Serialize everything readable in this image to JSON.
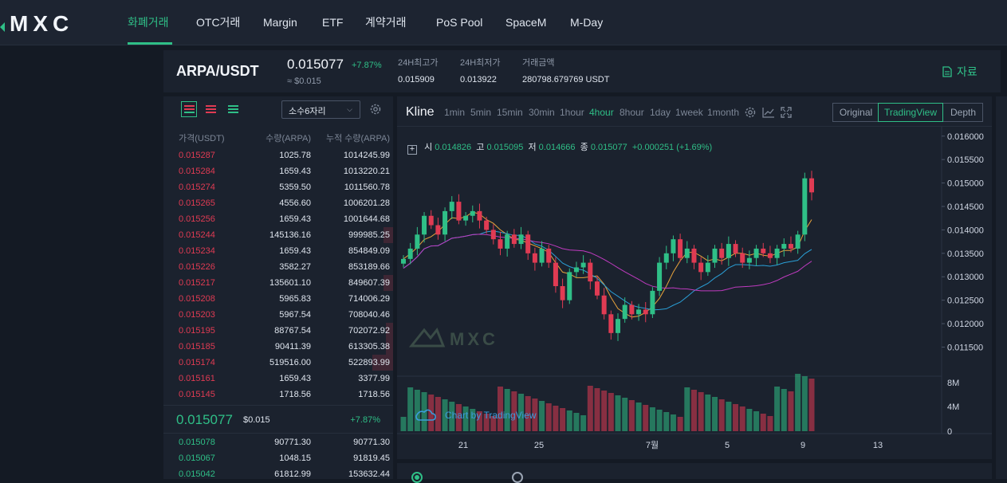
{
  "nav": {
    "logo_text": "MXC",
    "items": [
      "화폐거래",
      "OTC거래",
      "Margin",
      "ETF",
      "계약거래",
      "PoS Pool",
      "SpaceM",
      "M-Day"
    ],
    "active": "화폐거래"
  },
  "ticker": {
    "pair": "ARPA/USDT",
    "price": "0.015077",
    "change": "+7.87%",
    "approx": "≈ $0.015",
    "high_label": "24H최고가",
    "high_value": "0.015909",
    "low_label": "24H최저가",
    "low_value": "0.013922",
    "volume_label": "거래금액",
    "volume_value": "280798.679769 USDT",
    "info_label": "자료"
  },
  "orderbook": {
    "decimals_label": "소수6자리",
    "headers": {
      "price": "가격(USDT)",
      "qty": "수량(ARPA)",
      "cum": "누적 수량(ARPA)"
    },
    "asks": [
      {
        "price": "0.015287",
        "qty": "1025.78",
        "cum": "1014245.99",
        "depth": 0.0
      },
      {
        "price": "0.015284",
        "qty": "1659.43",
        "cum": "1013220.21",
        "depth": 0.0
      },
      {
        "price": "0.015274",
        "qty": "5359.50",
        "cum": "1011560.78",
        "depth": 0.0
      },
      {
        "price": "0.015265",
        "qty": "4556.60",
        "cum": "1006201.28",
        "depth": 0.0
      },
      {
        "price": "0.015256",
        "qty": "1659.43",
        "cum": "1001644.68",
        "depth": 0.0
      },
      {
        "price": "0.015244",
        "qty": "145136.16",
        "cum": "999985.25",
        "depth": 0.04
      },
      {
        "price": "0.015234",
        "qty": "1659.43",
        "cum": "854849.09",
        "depth": 0.0
      },
      {
        "price": "0.015226",
        "qty": "3582.27",
        "cum": "853189.66",
        "depth": 0.0
      },
      {
        "price": "0.015217",
        "qty": "135601.10",
        "cum": "849607.39",
        "depth": 0.04
      },
      {
        "price": "0.015208",
        "qty": "5965.83",
        "cum": "714006.29",
        "depth": 0.0
      },
      {
        "price": "0.015203",
        "qty": "5967.54",
        "cum": "708040.46",
        "depth": 0.0
      },
      {
        "price": "0.015195",
        "qty": "88767.54",
        "cum": "702072.92",
        "depth": 0.03
      },
      {
        "price": "0.015185",
        "qty": "90411.39",
        "cum": "613305.38",
        "depth": 0.03
      },
      {
        "price": "0.015174",
        "qty": "519516.00",
        "cum": "522893.99",
        "depth": 0.09
      },
      {
        "price": "0.015161",
        "qty": "1659.43",
        "cum": "3377.99",
        "depth": 0.0
      },
      {
        "price": "0.015145",
        "qty": "1718.56",
        "cum": "1718.56",
        "depth": 0.0
      }
    ],
    "mid": {
      "price": "0.015077",
      "usd": "$0.015",
      "change": "+7.87%"
    },
    "bids": [
      {
        "price": "0.015078",
        "qty": "90771.30",
        "cum": "90771.30"
      },
      {
        "price": "0.015067",
        "qty": "1048.15",
        "cum": "91819.45"
      },
      {
        "price": "0.015042",
        "qty": "61812.99",
        "cum": "153632.44"
      }
    ]
  },
  "chart": {
    "title": "Kline",
    "intervals": [
      "1min",
      "5min",
      "15min",
      "30min",
      "1hour",
      "4hour",
      "8hour",
      "1day",
      "1week",
      "1month"
    ],
    "active_interval": "4hour",
    "views": [
      "Original",
      "TradingView",
      "Depth"
    ],
    "active_view": "TradingView",
    "ohlc": {
      "o_label": "시",
      "o": "0.014826",
      "h_label": "고",
      "h": "0.015095",
      "l_label": "저",
      "l": "0.014666",
      "c_label": "종",
      "c": "0.015077",
      "change": "+0.000251 (+1.69%)"
    },
    "watermark": "MXC",
    "attribution": "Chart by TradingView",
    "colors": {
      "up": "#2fbf87",
      "down": "#e03b53",
      "ma1": "#e6a23c",
      "ma2": "#2a9fd6",
      "ma3": "#c03bc0"
    }
  },
  "chart_data": {
    "type": "candlestick",
    "y_ticks": [
      "0.016000",
      "0.015500",
      "0.015000",
      "0.014500",
      "0.014000",
      "0.013500",
      "0.013000",
      "0.012500",
      "0.012000",
      "0.011500"
    ],
    "ylim": [
      0.0111,
      0.0162
    ],
    "x_ticks": [
      "21",
      "25",
      "7월",
      "5",
      "9",
      "13"
    ],
    "volume_ticks": [
      "8M",
      "4M",
      "0"
    ],
    "close_prices": [
      0.01338,
      0.0136,
      0.0139,
      0.0143,
      0.0141,
      0.0139,
      0.0144,
      0.0146,
      0.0142,
      0.0143,
      0.0144,
      0.0142,
      0.014,
      0.0138,
      0.0136,
      0.0139,
      0.0137,
      0.0139,
      0.0135,
      0.0133,
      0.0136,
      0.0133,
      0.0128,
      0.0125,
      0.0131,
      0.0132,
      0.0133,
      0.0129,
      0.0126,
      0.0122,
      0.0118,
      0.0121,
      0.0124,
      0.0122,
      0.0123,
      0.0122,
      0.0127,
      0.0133,
      0.0135,
      0.0138,
      0.0134,
      0.0136,
      0.0133,
      0.0131,
      0.0133,
      0.0136,
      0.0134,
      0.0137,
      0.0135,
      0.0133,
      0.0134,
      0.0136,
      0.0135,
      0.0134,
      0.0136,
      0.0137,
      0.0136,
      0.0139,
      0.0151,
      0.0148
    ]
  }
}
